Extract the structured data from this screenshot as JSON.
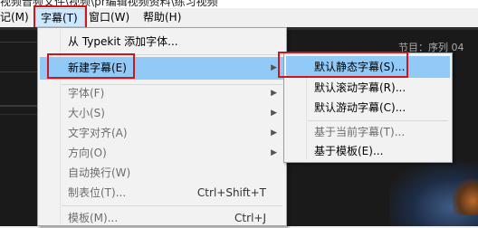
{
  "window": {
    "title_fragment": "视频音频文件\\视频\\pr编辑视频资料\\练习视频"
  },
  "menubar": {
    "items": [
      {
        "label": "记(M)"
      },
      {
        "label": "字幕(T)"
      },
      {
        "label": "窗口(W)"
      },
      {
        "label": "帮助(H)"
      }
    ],
    "active": "字幕(T)"
  },
  "background_panel": {
    "tabs_text": "节目：序列 04"
  },
  "title_menu": {
    "items": [
      {
        "label": "从 Typekit 添加字体...",
        "shortcut": "",
        "submenu": false,
        "disabled": false
      },
      {
        "label": "新建字幕(E)",
        "shortcut": "",
        "submenu": true,
        "disabled": false,
        "highlighted": true
      },
      {
        "label": "字体(F)",
        "shortcut": "",
        "submenu": true,
        "disabled": true
      },
      {
        "label": "大小(S)",
        "shortcut": "",
        "submenu": true,
        "disabled": true
      },
      {
        "label": "文字对齐(A)",
        "shortcut": "",
        "submenu": true,
        "disabled": true
      },
      {
        "label": "方向(O)",
        "shortcut": "",
        "submenu": true,
        "disabled": true
      },
      {
        "label": "自动换行(W)",
        "shortcut": "",
        "submenu": false,
        "disabled": true
      },
      {
        "label": "制表位(T)...",
        "shortcut": "Ctrl+Shift+T",
        "submenu": false,
        "disabled": true
      },
      {
        "label": "模板(M)...",
        "shortcut": "Ctrl+J",
        "submenu": false,
        "disabled": true
      }
    ]
  },
  "new_title_submenu": {
    "items": [
      {
        "label": "默认静态字幕(S)...",
        "disabled": false,
        "highlighted": true
      },
      {
        "label": "默认滚动字幕(R)...",
        "disabled": false
      },
      {
        "label": "默认游动字幕(C)...",
        "disabled": false
      },
      {
        "label": "基于当前字幕(T)...",
        "disabled": true
      },
      {
        "label": "基于模板(E)...",
        "disabled": false
      }
    ]
  }
}
